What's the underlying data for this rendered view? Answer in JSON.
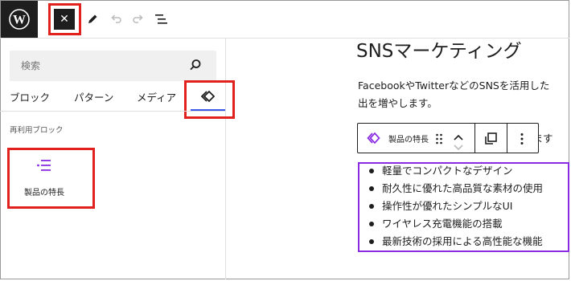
{
  "toolbar": {
    "close_symbol": "✕",
    "icons": [
      "wordpress-logo",
      "close-icon",
      "pencil-icon",
      "undo-icon",
      "redo-icon",
      "list-view-icon"
    ]
  },
  "inserter": {
    "search_placeholder": "検索",
    "tabs": [
      {
        "label": "ブロック"
      },
      {
        "label": "パターン"
      },
      {
        "label": "メディア"
      },
      {
        "label": "",
        "icon": "reusable-block-icon",
        "active": true
      }
    ],
    "section_label": "再利用ブロック",
    "items": [
      {
        "label": "製品の特長",
        "icon": "list-icon"
      }
    ]
  },
  "editor": {
    "heading": "SNSマーケティング",
    "paragraph_line1": "FacebookやTwitterなどのSNSを活用した",
    "paragraph_line2": "出を増やします。",
    "paragraph_tail": "ります",
    "block_toolbar": {
      "label": "製品の特長"
    },
    "list_items": [
      "軽量でコンパクトなデザイン",
      "耐久性に優れた高品質な素材の使用",
      "操作性が優れたシンプルなUI",
      "ワイヤレス充電機能の搭載",
      "最新技術の採用による高性能な機能"
    ]
  },
  "colors": {
    "highlight_red": "#e0211d",
    "accent_blue": "#3858e9",
    "block_purple": "#8a2be2"
  }
}
